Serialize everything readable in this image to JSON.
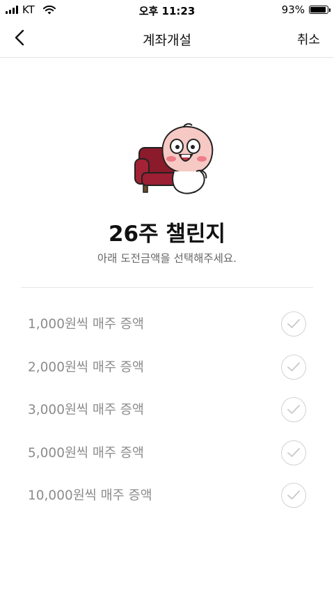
{
  "status_bar": {
    "carrier": "KT",
    "time": "오후 11:23",
    "battery_percent": "93%",
    "battery_level": 0.93,
    "icons": [
      "signal-icon",
      "wifi-icon",
      "battery-icon"
    ]
  },
  "nav": {
    "title": "계좌개설",
    "cancel_label": "취소",
    "back_icon": "chevron-left-icon"
  },
  "illustration": "character-on-sofa",
  "challenge": {
    "title": "26주 챌린지",
    "subtitle": "아래 도전금액을 선택해주세요."
  },
  "options": [
    {
      "label": "1,000원씩 매주 증액",
      "selected": false
    },
    {
      "label": "2,000원씩 매주 증액",
      "selected": false
    },
    {
      "label": "3,000원씩 매주 증액",
      "selected": false
    },
    {
      "label": "5,000원씩 매주 증액",
      "selected": false
    },
    {
      "label": "10,000원씩 매주 증액",
      "selected": false
    }
  ],
  "colors": {
    "option_text": "#8c8c8c",
    "check_border": "#d2d2d2",
    "sofa": "#8b1a2b",
    "character_skin": "#f6c9c4"
  }
}
